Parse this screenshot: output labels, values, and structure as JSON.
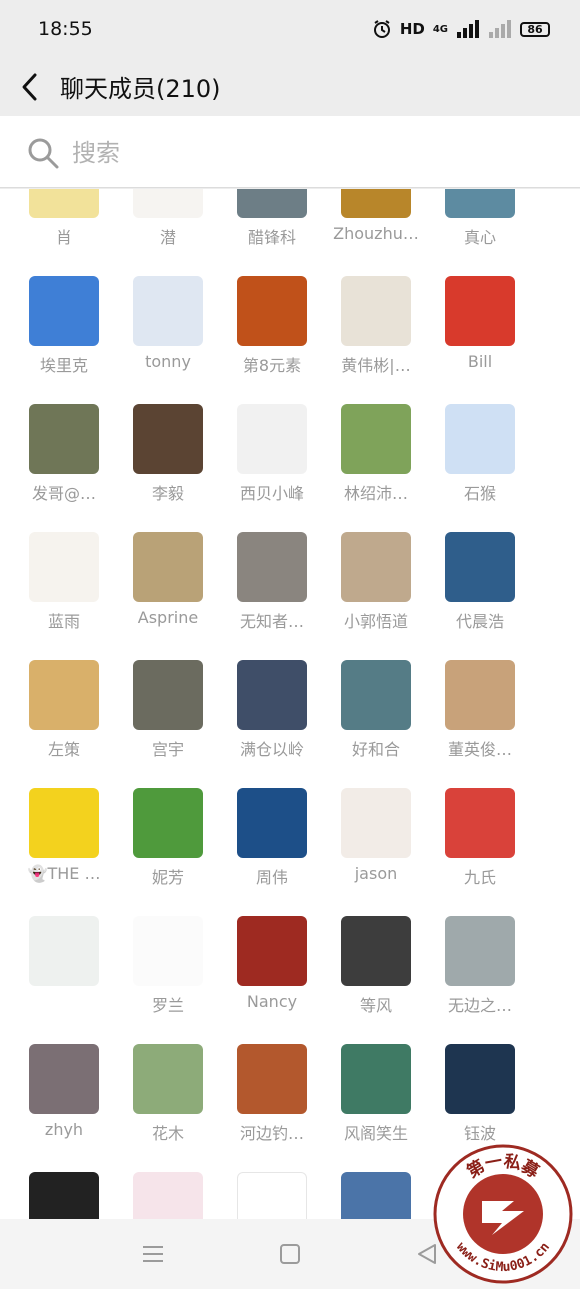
{
  "status": {
    "time": "18:55",
    "network": "HD",
    "net_type": "4G",
    "battery": "86"
  },
  "header": {
    "title": "聊天成员(210)"
  },
  "search": {
    "placeholder": "搜索"
  },
  "members": [
    {
      "name": "肖",
      "color": "#f2e29a"
    },
    {
      "name": "潜",
      "color": "#f6f4f1"
    },
    {
      "name": "醋锋科",
      "color": "#6d7e86"
    },
    {
      "name": "Zhouzhu…",
      "color": "#b8862a"
    },
    {
      "name": "真心",
      "color": "#5d8ba1"
    },
    {
      "name": "埃里克",
      "color": "#3f7fd6"
    },
    {
      "name": "tonny",
      "color": "#dfe7f2"
    },
    {
      "name": "第8元素",
      "color": "#c0511a"
    },
    {
      "name": "黄伟彬|…",
      "color": "#e8e2d7"
    },
    {
      "name": "Bill",
      "color": "#d83a2c"
    },
    {
      "name": "发哥@…",
      "color": "#6f7657"
    },
    {
      "name": "李毅",
      "color": "#5b4433"
    },
    {
      "name": "西贝小峰",
      "color": "#f1f1f1"
    },
    {
      "name": "林绍沛…",
      "color": "#7fa35a"
    },
    {
      "name": "石猴",
      "color": "#cfe0f4"
    },
    {
      "name": "蓝雨",
      "color": "#f6f3ee"
    },
    {
      "name": "Asprine",
      "color": "#b9a277"
    },
    {
      "name": "无知者…",
      "color": "#8a857f"
    },
    {
      "name": "小郭悟道",
      "color": "#bfa98d"
    },
    {
      "name": "代晨浩",
      "color": "#2f5e8b"
    },
    {
      "name": "左策",
      "color": "#d9b06a"
    },
    {
      "name": "宫宇",
      "color": "#6b6b5f"
    },
    {
      "name": "满仓以岭",
      "color": "#3f4e68"
    },
    {
      "name": "好和合",
      "color": "#557c86"
    },
    {
      "name": "董英俊…",
      "color": "#c8a27a"
    },
    {
      "name": "👻THE …",
      "color": "#f3d21e"
    },
    {
      "name": "妮芳",
      "color": "#4f9a3c"
    },
    {
      "name": "周伟",
      "color": "#1d4f88"
    },
    {
      "name": "jason",
      "color": "#f2ece7"
    },
    {
      "name": "九氏",
      "color": "#d9423a"
    },
    {
      "name": "",
      "color": "#eef1ef"
    },
    {
      "name": "罗兰",
      "color": "#fbfbfb"
    },
    {
      "name": "Nancy",
      "color": "#9e2a21"
    },
    {
      "name": "等风",
      "color": "#3d3d3d"
    },
    {
      "name": "无边之…",
      "color": "#9fa9ab"
    },
    {
      "name": "zhyh",
      "color": "#7b6f74"
    },
    {
      "name": "花木",
      "color": "#8dab79"
    },
    {
      "name": "河边钓…",
      "color": "#b3582d"
    },
    {
      "name": "风阁笑生",
      "color": "#3f7a64"
    },
    {
      "name": "钰波",
      "color": "#1e3550"
    },
    {
      "name": "",
      "color": "#222222"
    },
    {
      "name": "",
      "color": "#f6e4ea"
    },
    {
      "name": "",
      "color": "#ffffff"
    },
    {
      "name": "",
      "color": "#4b74a8"
    },
    {
      "name": "",
      "color": "#ffffff"
    }
  ],
  "watermark": {
    "top": "第一私募",
    "bottom": "www.SiMu001.cn"
  },
  "icons": {
    "back": "chevron-left-icon",
    "search": "magnifier-icon",
    "menu": "recent-apps-icon",
    "home": "home-square-icon",
    "nav_back": "triangle-back-icon"
  },
  "colors": {
    "background": "#ededed",
    "text_secondary": "#9a9a9a",
    "watermark_red": "#c0392b"
  }
}
